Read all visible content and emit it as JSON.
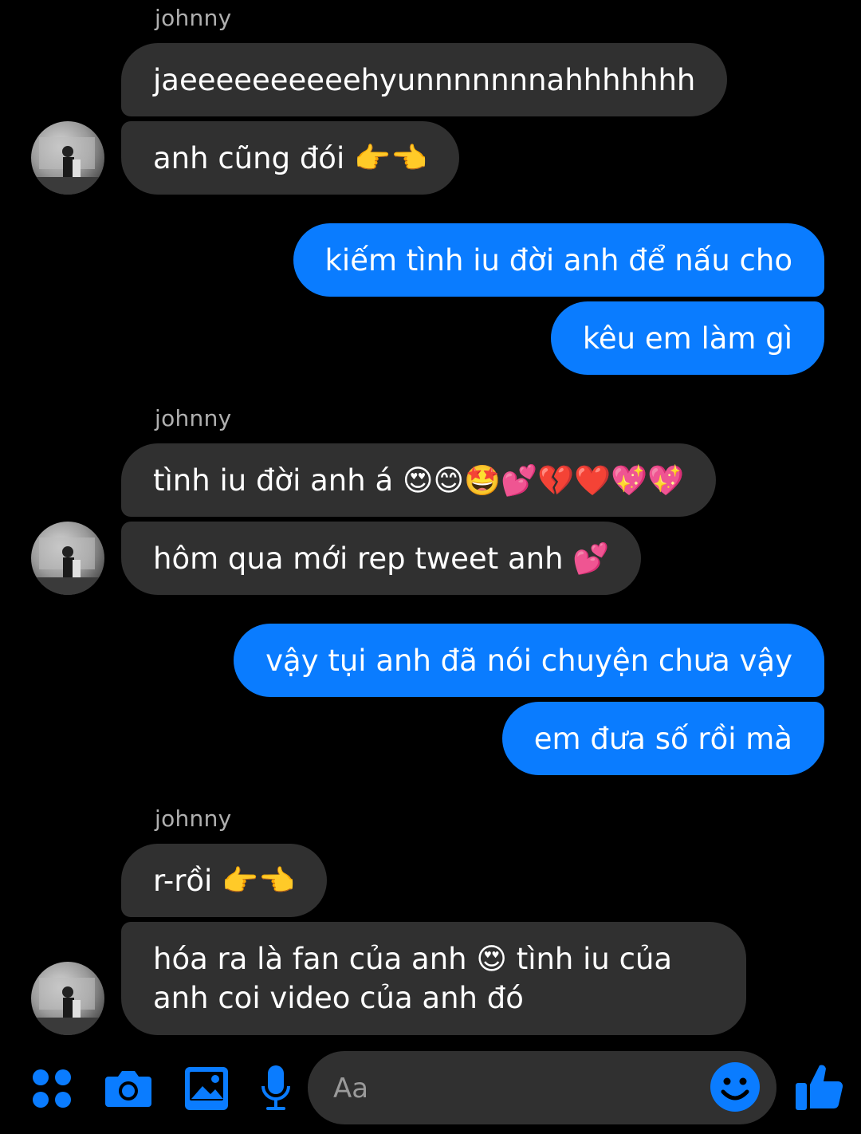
{
  "app": "Messenger",
  "colors": {
    "background": "#000000",
    "incoming_bubble": "#303030",
    "outgoing_bubble": "#0a7cff",
    "accent": "#0a7cff"
  },
  "groups": [
    {
      "sender": "johnny",
      "messages": [
        "jaeeeeeeeeeehyunnnnnnnahhhhhhh",
        "anh cũng đói 👉👈"
      ]
    },
    {
      "sender": "me",
      "messages": [
        "kiếm tình iu đời anh để nấu cho",
        "kêu em làm gì"
      ]
    },
    {
      "sender": "johnny",
      "messages": [
        "tình iu đời anh á 😍😊🤩💕💔❤️💖💖",
        "hôm qua mới rep tweet anh 💕"
      ]
    },
    {
      "sender": "me",
      "messages": [
        "vậy tụi anh đã nói chuyện chưa vậy",
        "em đưa số rồi mà"
      ]
    },
    {
      "sender": "johnny",
      "messages": [
        "r-rồi 👉👈",
        "hóa ra là fan của anh 😍 tình iu của anh coi video của anh đó"
      ]
    }
  ],
  "composer": {
    "placeholder": "Aa",
    "icons": [
      "apps-grid-icon",
      "camera-icon",
      "gallery-icon",
      "microphone-icon",
      "emoji-icon",
      "like-thumbs-up-icon"
    ]
  }
}
